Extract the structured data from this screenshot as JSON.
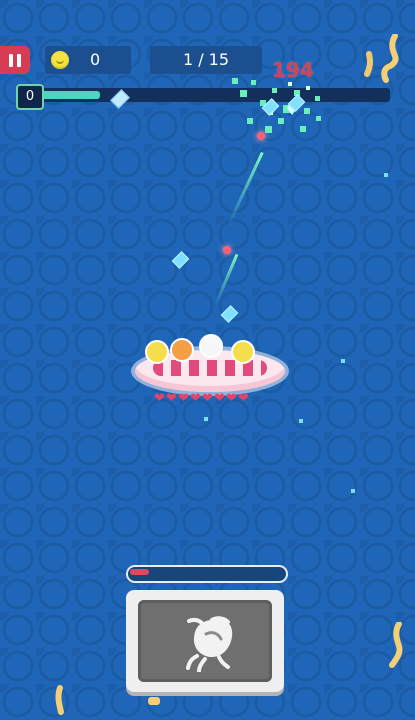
{
  "hud": {
    "coins": "0",
    "wave": "1 / 15",
    "level": "0",
    "wave_progress": 0.22
  },
  "combat": {
    "damage_text": "194",
    "hearts": [
      "❤",
      "❤",
      "❤",
      "❤",
      "❤",
      "❤",
      "❤",
      "❤"
    ]
  },
  "ability": {
    "cooldown": 0.12,
    "icon": "beetle-icon"
  },
  "colors": {
    "background": "#1f66b8",
    "accent_red": "#d83b54",
    "progress_fill": "#49d7c1"
  }
}
